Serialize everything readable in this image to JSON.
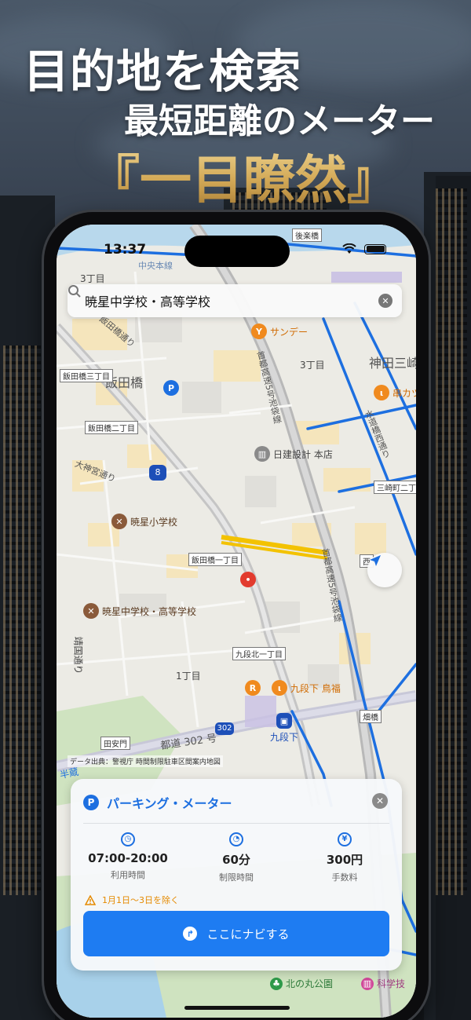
{
  "headline": {
    "line1": "目的地を検索",
    "line2": "最短距離のメーター",
    "line3": "『一目瞭然』"
  },
  "status_bar": {
    "time": "13:37"
  },
  "search": {
    "query": "暁星中学校・高等学校"
  },
  "map_labels": {
    "choume3_top": "3丁目",
    "iidabashi": "飯田橋",
    "kanda_misaki": "神田三崎",
    "choume3_mid": "3丁目",
    "choume1": "1丁目",
    "kudanshita_station": "九段下",
    "iidabashi_sanchome": "飯田橋三丁目",
    "iidabashi_nichome": "飯田橋二丁目",
    "iidabashi_itchome": "飯田橋一丁目",
    "kudankita_itchome": "九段北一丁目",
    "tayasumon": "田安門",
    "misakicho_nichome": "三崎町二丁目",
    "nishi": "西",
    "hitotsubashi": "畑橋",
    "korakubashi": "後楽橋",
    "chuohonsen": "中央本線",
    "iidabashi_dori": "飯田橋通り",
    "daijingu_dori": "大神宮通り",
    "toshi_302": "都道 302 号",
    "route_302": "302",
    "route_8": "8",
    "expressway_5_top": "首都高速5号池袋線",
    "expressway_5_bottom": "首都高速5号池袋線",
    "suido_bashi": "水道橋西通り",
    "harami_dori": "半蔵",
    "kitanomaru": "北の丸公園",
    "kagaku": "科学技",
    "yasukuni_side": "靖国通り"
  },
  "pois": {
    "sunday": "サンデー",
    "nikken": "日建設計 本店",
    "gyosei_elem": "暁星小学校",
    "gyosei_high": "暁星中学校・高等学校",
    "kudanshita_torifuku": "九段下 鳥福",
    "kushikatsu": "串カツ"
  },
  "attribution": "データ出典：警視庁 時間制限駐車区間案内地図",
  "card": {
    "badge": "P",
    "title": "パーキング・メーター",
    "stats": [
      {
        "icon": "clock-icon",
        "value": "07:00-20:00",
        "label": "利用時間"
      },
      {
        "icon": "timer-icon",
        "value": "60分",
        "label": "制限時間"
      },
      {
        "icon": "yen-icon",
        "value": "300円",
        "label": "手数料"
      }
    ],
    "warning": "1月1日～3日を除く",
    "nav_button": "ここにナビする"
  },
  "colors": {
    "accent": "#1e7cf2",
    "warning": "#e58a00",
    "gold": "#d3a957",
    "road_blue": "#1d6fe0",
    "highlight_road": "#f3c200"
  }
}
